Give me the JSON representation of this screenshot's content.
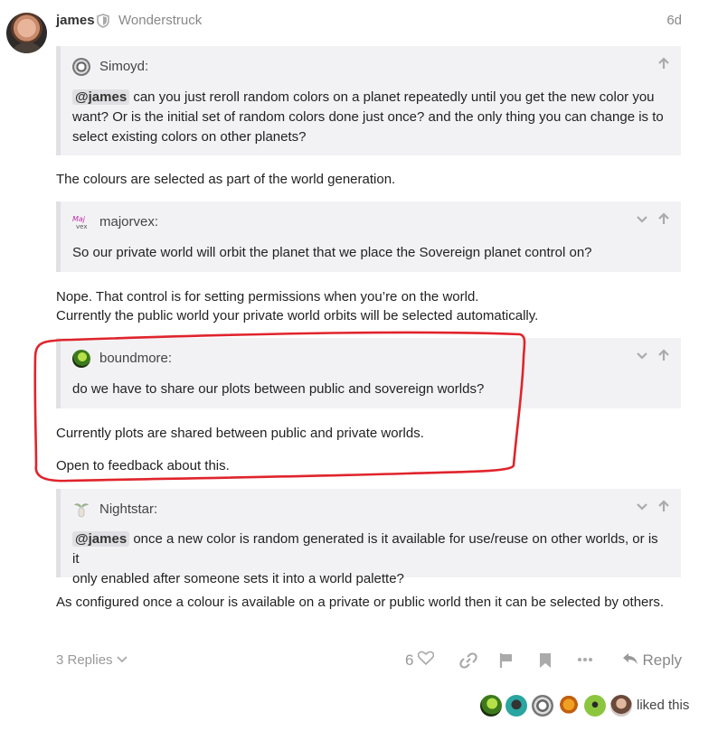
{
  "post": {
    "username": "james",
    "user_title": "Wonderstruck",
    "time": "6d",
    "blocks": [
      {
        "type": "quote",
        "author": "Simoyd:",
        "mention": "@james",
        "text_line1": "can you just reroll random colors on a planet repeatedly until you get the new color you",
        "text_line2": "want? Or is the initial set of random colors done just once? and the only thing you can change is to",
        "text_line3": "select existing colors on other planets?"
      },
      {
        "type": "paragraph",
        "text": "The colours are selected as part of the world generation."
      },
      {
        "type": "quote",
        "author": "majorvex:",
        "text": "So our private world will orbit the planet that we place the Sovereign planet control on?"
      },
      {
        "type": "paragraph",
        "text": "Nope. That control is for setting permissions when you’re on the world."
      },
      {
        "type": "paragraph",
        "text": "Currently the public world your private world orbits will be selected automatically."
      },
      {
        "type": "quote",
        "author": "boundmore:",
        "text": "do we have to share our plots between public and sovereign worlds?"
      },
      {
        "type": "paragraph",
        "text": "Currently plots are shared between public and private worlds."
      },
      {
        "type": "paragraph",
        "text": "Open to feedback about this."
      },
      {
        "type": "quote",
        "author": "Nightstar:",
        "mention": "@james",
        "text_line1": "once a new color is random generated is it available for use/reuse on other worlds, or is it",
        "text_line2": "only enabled after someone sets it into a world palette?"
      },
      {
        "type": "paragraph",
        "text": "As configured once a colour is available on a private or public world then it can be selected by others."
      }
    ]
  },
  "footer": {
    "replies_label": "3 Replies",
    "like_count": "6",
    "reply_label": "Reply",
    "liked_label": "liked this"
  },
  "colors": {
    "quote_bg": "#f2f2f5",
    "annotation_red": "#e0242c",
    "muted": "#999999"
  },
  "icons": [
    "shield-icon",
    "chevron-down-icon",
    "arrow-up-icon",
    "heart-icon",
    "link-icon",
    "flag-icon",
    "bookmark-icon",
    "more-icon",
    "reply-icon"
  ]
}
